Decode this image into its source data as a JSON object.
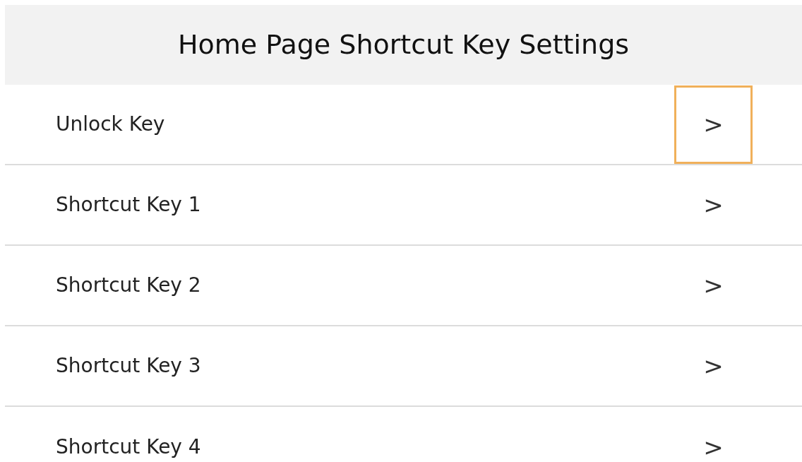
{
  "header": {
    "title": "Home Page Shortcut Key Settings"
  },
  "rows": [
    {
      "label": "Unlock Key",
      "chevron": ">",
      "focused": true
    },
    {
      "label": "Shortcut Key 1",
      "chevron": ">",
      "focused": false
    },
    {
      "label": "Shortcut Key 2",
      "chevron": ">",
      "focused": false
    },
    {
      "label": "Shortcut Key 3",
      "chevron": ">",
      "focused": false
    },
    {
      "label": "Shortcut Key 4",
      "chevron": ">",
      "focused": false
    }
  ]
}
